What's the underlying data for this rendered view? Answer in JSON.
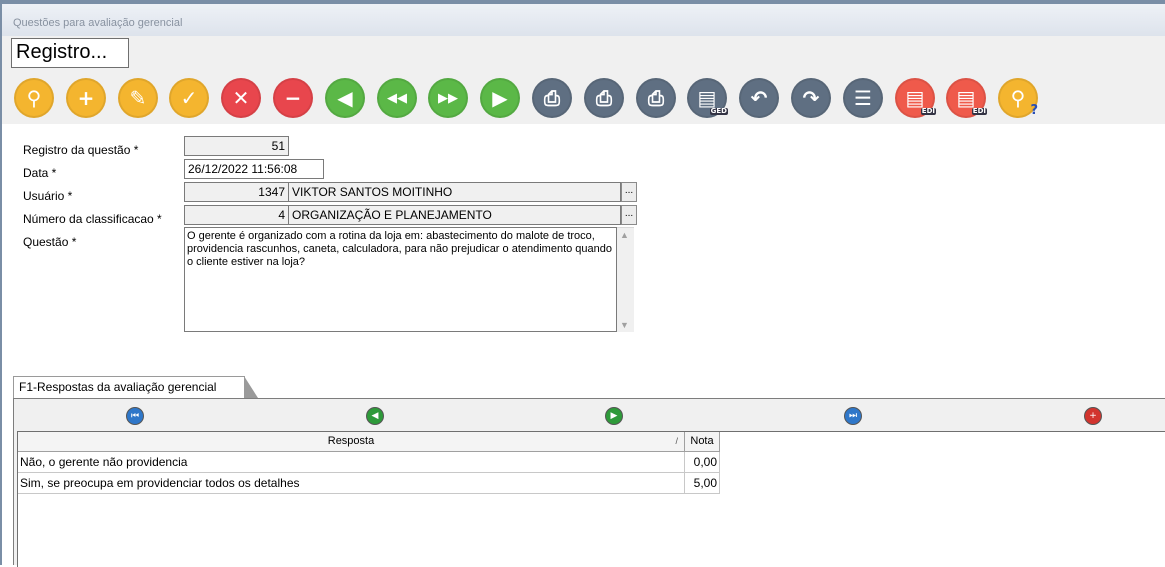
{
  "window": {
    "title": "Questões para avaliação gerencial"
  },
  "header": {
    "registro_label": "Registro..."
  },
  "toolbar": {
    "buttons": [
      {
        "name": "search-icon",
        "glyph": "⚲",
        "color": "#f4b52f"
      },
      {
        "name": "add-icon",
        "glyph": "+",
        "color": "#f4b52f"
      },
      {
        "name": "edit-icon",
        "glyph": "✎",
        "color": "#f4b52f"
      },
      {
        "name": "confirm-icon",
        "glyph": "✓",
        "color": "#f4b52f"
      },
      {
        "name": "cancel-icon",
        "glyph": "✕",
        "color": "#e8464d"
      },
      {
        "name": "delete-icon",
        "glyph": "−",
        "color": "#e8464d"
      },
      {
        "name": "first-record-icon",
        "glyph": "◀",
        "color": "#5bb847"
      },
      {
        "name": "previous-record-icon",
        "glyph": "◀◀",
        "color": "#5bb847"
      },
      {
        "name": "next-record-icon",
        "glyph": "▶▶",
        "color": "#5bb847"
      },
      {
        "name": "last-record-icon",
        "glyph": "▶",
        "color": "#5bb847"
      },
      {
        "name": "print-preview-icon",
        "glyph": "⎙",
        "color": "#5f6f82"
      },
      {
        "name": "print-icon",
        "glyph": "⎙",
        "color": "#5f6f82"
      },
      {
        "name": "print-email-icon",
        "glyph": "⎙",
        "color": "#5f6f82"
      },
      {
        "name": "ged-icon",
        "glyph": "▤",
        "color": "#5f6f82",
        "tag": "GED"
      },
      {
        "name": "undo-icon",
        "glyph": "↶",
        "color": "#5f6f82"
      },
      {
        "name": "redo-icon",
        "glyph": "↷",
        "color": "#5f6f82"
      },
      {
        "name": "export-list-icon",
        "glyph": "☰",
        "color": "#5f6f82"
      },
      {
        "name": "edi-export-icon",
        "glyph": "▤",
        "color": "#ef5a4b",
        "tag": "EDI"
      },
      {
        "name": "edi-import-icon",
        "glyph": "▤",
        "color": "#ef5a4b",
        "tag": "EDI"
      },
      {
        "name": "help-search-icon",
        "glyph": "⚲",
        "color": "#f4b52f",
        "q": "?"
      }
    ]
  },
  "form": {
    "registro_label": "Registro da questão *",
    "registro_value": "51",
    "data_label": "Data *",
    "data_value": "26/12/2022 11:56:08",
    "usuario_label": "Usuário *",
    "usuario_code": "1347",
    "usuario_name": "VIKTOR SANTOS MOITINHO",
    "classificacao_label": "Número da classificacao *",
    "classificacao_code": "4",
    "classificacao_name": "ORGANIZAÇÃO E PLANEJAMENTO",
    "questao_label": "Questão *",
    "questao_value": "O gerente é organizado com a rotina da loja em: abastecimento do malote de troco, providencia rascunhos, caneta, calculadora, para não prejudicar o atendimento quando o cliente estiver na loja?",
    "lookup_button": "..."
  },
  "tab": {
    "label": "F1-Respostas da avaliação gerencial"
  },
  "grid": {
    "columns": {
      "resposta": "Resposta",
      "nota": "Nota",
      "sort_glyph": "/"
    },
    "rows": [
      {
        "resposta": "Não, o gerente não providencia",
        "nota": "0,00"
      },
      {
        "resposta": "Sim, se preocupa em providenciar todos os detalhes",
        "nota": "5,00"
      }
    ]
  }
}
